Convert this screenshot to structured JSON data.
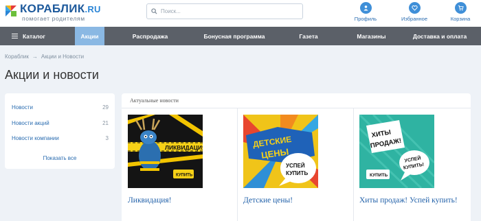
{
  "header": {
    "logo_main": "КОРАБЛИК",
    "logo_domain": ".RU",
    "logo_tagline": "помогает родителям",
    "search_placeholder": "Поиск...",
    "icons": [
      {
        "label": "Профиль",
        "icon": "user-icon"
      },
      {
        "label": "Избранное",
        "icon": "heart-icon"
      },
      {
        "label": "Корзина",
        "icon": "cart-icon"
      }
    ]
  },
  "nav": {
    "items": [
      {
        "label": "Каталог",
        "icon": "menu-icon"
      },
      {
        "label": "Акции",
        "active": true
      },
      {
        "label": "Распродажа"
      },
      {
        "label": "Бонусная программа"
      },
      {
        "label": "Газета"
      },
      {
        "label": "Магазины"
      },
      {
        "label": "Доставка и оплата"
      }
    ]
  },
  "breadcrumb": {
    "home": "Кораблик",
    "separator": "→",
    "current": "Акции и Новости"
  },
  "page_title": "Акции и новости",
  "sidebar": {
    "items": [
      {
        "label": "Новости",
        "count": "29"
      },
      {
        "label": "Новости акций",
        "count": "21"
      },
      {
        "label": "Новости компании",
        "count": "3"
      }
    ],
    "show_all": "Показать все"
  },
  "news": {
    "heading": "Актуальные новости",
    "items": [
      {
        "title": "Ликвидация!",
        "banner_text": "ЛИКВИДАЦИЯ",
        "button": "КУПИТЬ"
      },
      {
        "title": "Детские цены!",
        "banner_line1": "ДЕТСКИЕ",
        "banner_line2": "ЦЕНЫ",
        "bubble1": "УСПЕЙ",
        "bubble2": "КУПИТЬ"
      },
      {
        "title": "Хиты продаж! Успей купить!",
        "banner_line1": "ХИТЫ",
        "banner_line2": "ПРОДАЖ!",
        "bubble1": "УСПЕЙ",
        "bubble2": "КУПИТЬ!",
        "button": "КУПИТЬ"
      }
    ]
  },
  "colors": {
    "brand_blue": "#1e5a9c",
    "link_blue": "#2a6cb0",
    "nav_bg": "#5b6068",
    "nav_active": "#8ab8e3",
    "page_bg": "#eef2f7"
  }
}
